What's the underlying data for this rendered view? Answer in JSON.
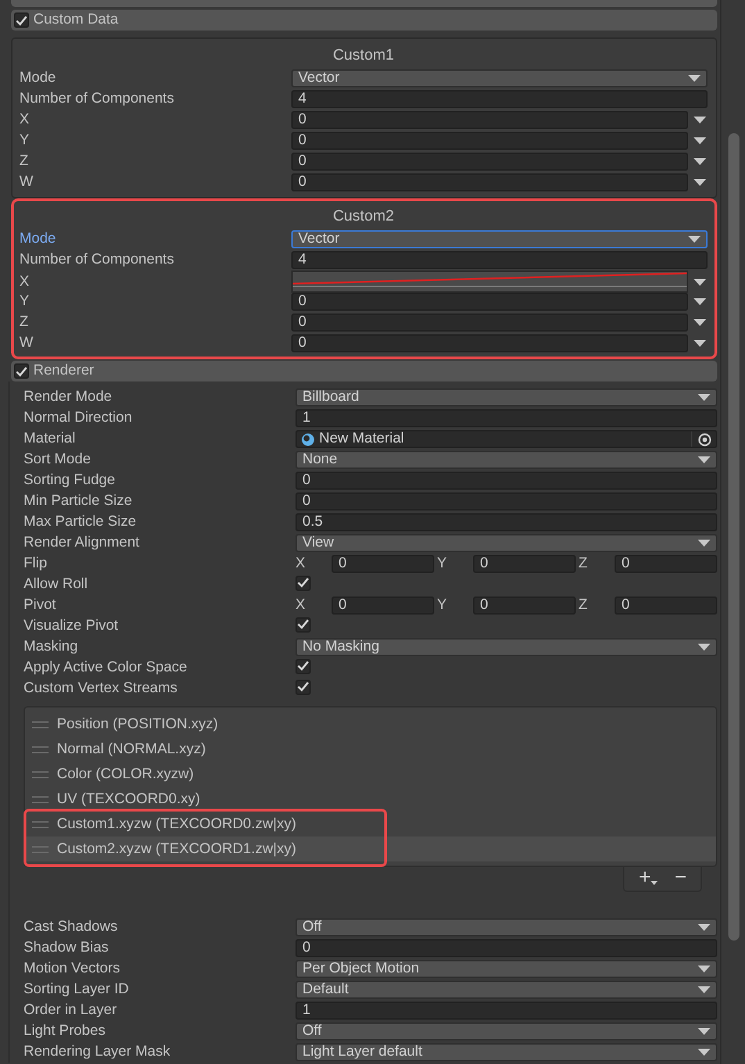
{
  "custom_data": {
    "title": "Custom Data",
    "checked": true,
    "panels": [
      {
        "title": "Custom1",
        "annotated": false,
        "fields": [
          {
            "label": "Mode",
            "kind": "dropdown",
            "value": "Vector",
            "focused": false
          },
          {
            "label": "Number of Components",
            "kind": "number",
            "value": "4",
            "focused": false
          },
          {
            "label": "X",
            "kind": "number_dropdown",
            "value": "0",
            "focused": false
          },
          {
            "label": "Y",
            "kind": "number_dropdown",
            "value": "0",
            "focused": false
          },
          {
            "label": "Z",
            "kind": "number_dropdown",
            "value": "0",
            "focused": false
          },
          {
            "label": "W",
            "kind": "number_dropdown",
            "value": "0",
            "focused": false
          }
        ]
      },
      {
        "title": "Custom2",
        "annotated": true,
        "fields": [
          {
            "label": "Mode",
            "kind": "dropdown",
            "value": "Vector",
            "focused": true
          },
          {
            "label": "Number of Components",
            "kind": "number",
            "value": "4",
            "focused": false
          },
          {
            "label": "X",
            "kind": "curve",
            "focused": false
          },
          {
            "label": "Y",
            "kind": "number_dropdown",
            "value": "0",
            "focused": false
          },
          {
            "label": "Z",
            "kind": "number_dropdown",
            "value": "0",
            "focused": false
          },
          {
            "label": "W",
            "kind": "number_dropdown",
            "value": "0",
            "focused": false
          }
        ]
      }
    ]
  },
  "renderer": {
    "title": "Renderer",
    "checked": true,
    "fields": [
      {
        "label": "Render Mode",
        "kind": "dropdown",
        "value": "Billboard"
      },
      {
        "label": "Normal Direction",
        "kind": "number",
        "value": "1"
      },
      {
        "label": "Material",
        "kind": "object",
        "value": "New Material"
      },
      {
        "label": "Sort Mode",
        "kind": "dropdown",
        "value": "None"
      },
      {
        "label": "Sorting Fudge",
        "kind": "number",
        "value": "0"
      },
      {
        "label": "Min Particle Size",
        "kind": "number",
        "value": "0"
      },
      {
        "label": "Max Particle Size",
        "kind": "number",
        "value": "0.5"
      },
      {
        "label": "Render Alignment",
        "kind": "dropdown",
        "value": "View"
      },
      {
        "label": "Flip",
        "kind": "vector3",
        "components": [
          {
            "axis": "X",
            "value": "0"
          },
          {
            "axis": "Y",
            "value": "0"
          },
          {
            "axis": "Z",
            "value": "0"
          }
        ]
      },
      {
        "label": "Allow Roll",
        "kind": "checkbox",
        "checked": true
      },
      {
        "label": "Pivot",
        "kind": "vector3",
        "components": [
          {
            "axis": "X",
            "value": "0"
          },
          {
            "axis": "Y",
            "value": "0"
          },
          {
            "axis": "Z",
            "value": "0"
          }
        ]
      },
      {
        "label": "Visualize Pivot",
        "kind": "checkbox",
        "checked": true
      },
      {
        "label": "Masking",
        "kind": "dropdown",
        "value": "No Masking"
      },
      {
        "label": "Apply Active Color Space",
        "kind": "checkbox",
        "checked": true
      },
      {
        "label": "Custom Vertex Streams",
        "kind": "checkbox",
        "checked": true
      }
    ],
    "streams": [
      {
        "label": "Position (POSITION.xyz)",
        "selected": false,
        "annotated": false
      },
      {
        "label": "Normal (NORMAL.xyz)",
        "selected": false,
        "annotated": false
      },
      {
        "label": "Color (COLOR.xyzw)",
        "selected": false,
        "annotated": false
      },
      {
        "label": "UV (TEXCOORD0.xy)",
        "selected": false,
        "annotated": false
      },
      {
        "label": "Custom1.xyzw (TEXCOORD0.zw|xy)",
        "selected": false,
        "annotated": true
      },
      {
        "label": "Custom2.xyzw (TEXCOORD1.zw|xy)",
        "selected": true,
        "annotated": true
      }
    ],
    "list_buttons": [
      "+",
      "−"
    ],
    "fields_after": [
      {
        "label": "Cast Shadows",
        "kind": "dropdown",
        "value": "Off"
      },
      {
        "label": "Shadow Bias",
        "kind": "number",
        "value": "0"
      },
      {
        "label": "Motion Vectors",
        "kind": "dropdown",
        "value": "Per Object Motion"
      },
      {
        "label": "Sorting Layer ID",
        "kind": "dropdown",
        "value": "Default"
      },
      {
        "label": "Order in Layer",
        "kind": "number",
        "value": "1"
      },
      {
        "label": "Light Probes",
        "kind": "dropdown",
        "value": "Off"
      },
      {
        "label": "Rendering Layer Mask",
        "kind": "dropdown",
        "value": "Light Layer default"
      }
    ]
  }
}
